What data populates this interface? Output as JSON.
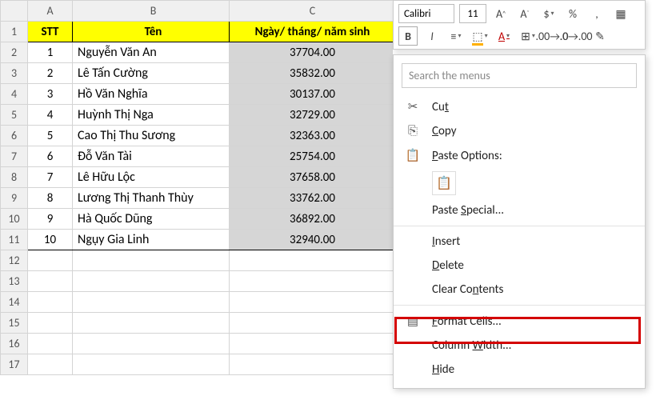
{
  "columns": {
    "A": "A",
    "B": "B",
    "C": "C"
  },
  "headers": {
    "stt": "STT",
    "ten": "Tên",
    "date": "Ngày/ tháng/ năm sinh"
  },
  "rows": [
    {
      "n": "1",
      "name": "Nguyễn Văn An",
      "val": "37704.00"
    },
    {
      "n": "2",
      "name": "Lê Tấn Cường",
      "val": "35832.00"
    },
    {
      "n": "3",
      "name": "Hồ Văn Nghĩa",
      "val": "30137.00"
    },
    {
      "n": "4",
      "name": "Huỳnh Thị Nga",
      "val": "32729.00"
    },
    {
      "n": "5",
      "name": "Cao Thị Thu Sương",
      "val": "32363.00"
    },
    {
      "n": "6",
      "name": "Đỗ Văn Tài",
      "val": "25754.00"
    },
    {
      "n": "7",
      "name": "Lê Hữu Lộc",
      "val": "37658.00"
    },
    {
      "n": "8",
      "name": "Lương Thị Thanh Thùy",
      "val": "33762.00"
    },
    {
      "n": "9",
      "name": "Hà Quốc Dũng",
      "val": "36892.00"
    },
    {
      "n": "10",
      "name": "Ngụy Gia Linh",
      "val": "32940.00"
    }
  ],
  "blank_rows": [
    "12",
    "13",
    "14",
    "15",
    "16",
    "17"
  ],
  "mini": {
    "font": "Calibri",
    "size": "11",
    "tips": {
      "inc": "A",
      "dec": "A",
      "dollar": "$",
      "pct": "%",
      "comma": ",",
      "bold": "B",
      "italic": "I",
      "align": "≡",
      "merge": "⮟",
      "fontcolor": "A",
      "border": "⊞",
      "fill": "⬚",
      "decinc": ".0",
      "brush": "✎"
    }
  },
  "menu": {
    "search_placeholder": "Search the menus",
    "cut": "Cut",
    "copy": "Copy",
    "paste_options": "Paste Options:",
    "paste_special": "Paste Special...",
    "insert": "Insert",
    "delete": "Delete",
    "clear": "Clear Contents",
    "format_cells": "Format Cells...",
    "col_width": "Column Width...",
    "hide": "Hide",
    "mn": {
      "cut": "t",
      "copy": "C",
      "paste": "P",
      "special": "S",
      "insert": "I",
      "delete": "D",
      "clear": "n",
      "format": "F",
      "width": "W",
      "hide": "H"
    }
  }
}
